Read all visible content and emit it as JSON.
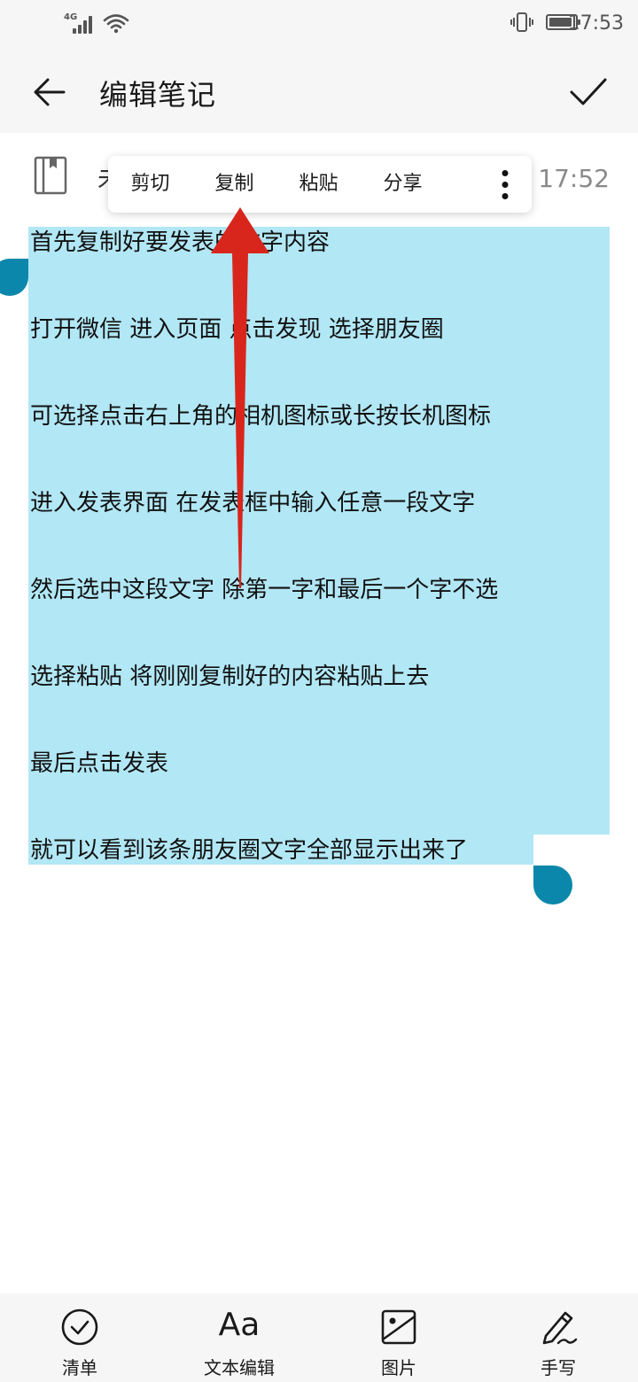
{
  "status_bar": {
    "network": "4G",
    "time": "17:53",
    "battery_level": 0.9
  },
  "header": {
    "title": "编辑笔记"
  },
  "note": {
    "title_partial": "未",
    "time_partial": "天 17:52"
  },
  "context_menu": {
    "items": [
      "剪切",
      "复制",
      "粘贴",
      "分享"
    ]
  },
  "content": {
    "lines": [
      "首先复制好要发表的文字内容",
      "打开微信  进入页面  点击发现  选择朋友圈",
      "可选择点击右上角的相机图标或长按长机图标",
      "进入发表界面  在发表框中输入任意一段文字",
      "然后选中这段文字 除第一字和最后一个字不选",
      "选择粘贴  将刚刚复制好的内容粘贴上去",
      "最后点击发表",
      "就可以看到该条朋友圈文字全部显示出来了"
    ]
  },
  "toolbar": {
    "checklist_label": "清单",
    "text_edit_label": "文本编辑",
    "text_edit_icon": "Aa",
    "image_label": "图片",
    "handwrite_label": "手写"
  },
  "colors": {
    "selection": "#b2e7f5",
    "handle": "#0a87ab",
    "annotation_arrow": "#d9261c",
    "bar_background": "#f6f6f6"
  }
}
